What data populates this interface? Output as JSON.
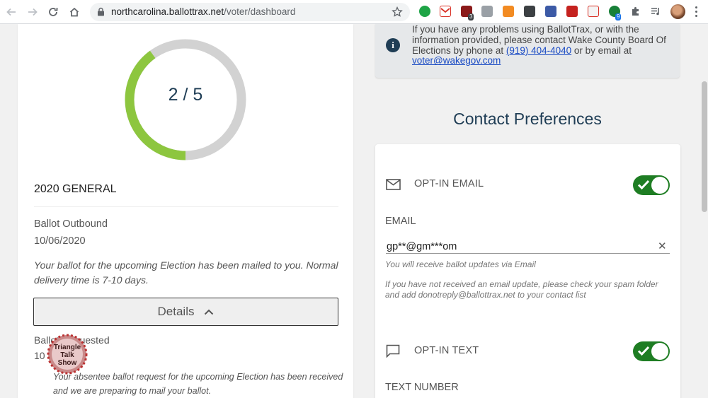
{
  "browser": {
    "url_host": "northcarolina.ballottrax.net",
    "url_path": "/voter/dashboard",
    "extension_badges": [
      "3",
      "9"
    ]
  },
  "dashboard": {
    "progress": {
      "current": 2,
      "total": 5,
      "text": "2 / 5",
      "fraction": 0.4,
      "color": "#8dc63f"
    },
    "election_title": "2020 GENERAL",
    "status": {
      "label": "Ballot Outbound",
      "date": "10/06/2020",
      "description": "Your ballot for the upcoming Election has been mailed to you. Normal delivery time is 7-10 days."
    },
    "details_label": "Details",
    "previous_status": {
      "label": "Ballot Requested",
      "date": "10",
      "description": "Your absentee ballot request for the upcoming Election has been received and we are preparing to mail your ballot."
    },
    "watermark_text": [
      "Triangle",
      "Talk",
      "Show"
    ]
  },
  "info": {
    "text_before": "If you have any problems using BallotTrax, or with the information provided, please contact Wake County Board Of Elections by phone at ",
    "phone": "(919) 404-4040",
    "text_middle": " or by email at ",
    "email": "voter@wakegov.com"
  },
  "contact": {
    "heading": "Contact Preferences",
    "email_optin_label": "OPT-IN EMAIL",
    "email_optin_on": true,
    "email_field_label": "EMAIL",
    "email_value": "gp**@gm***om",
    "email_hint": "You will receive ballot updates via Email",
    "spam_hint": "If you have not received an email update, please check your spam folder and add donotreply@ballottrax.net to your contact list",
    "text_optin_label": "OPT-IN TEXT",
    "text_optin_on": true,
    "text_number_label": "TEXT NUMBER",
    "toggle_color": "#1e7d23"
  }
}
